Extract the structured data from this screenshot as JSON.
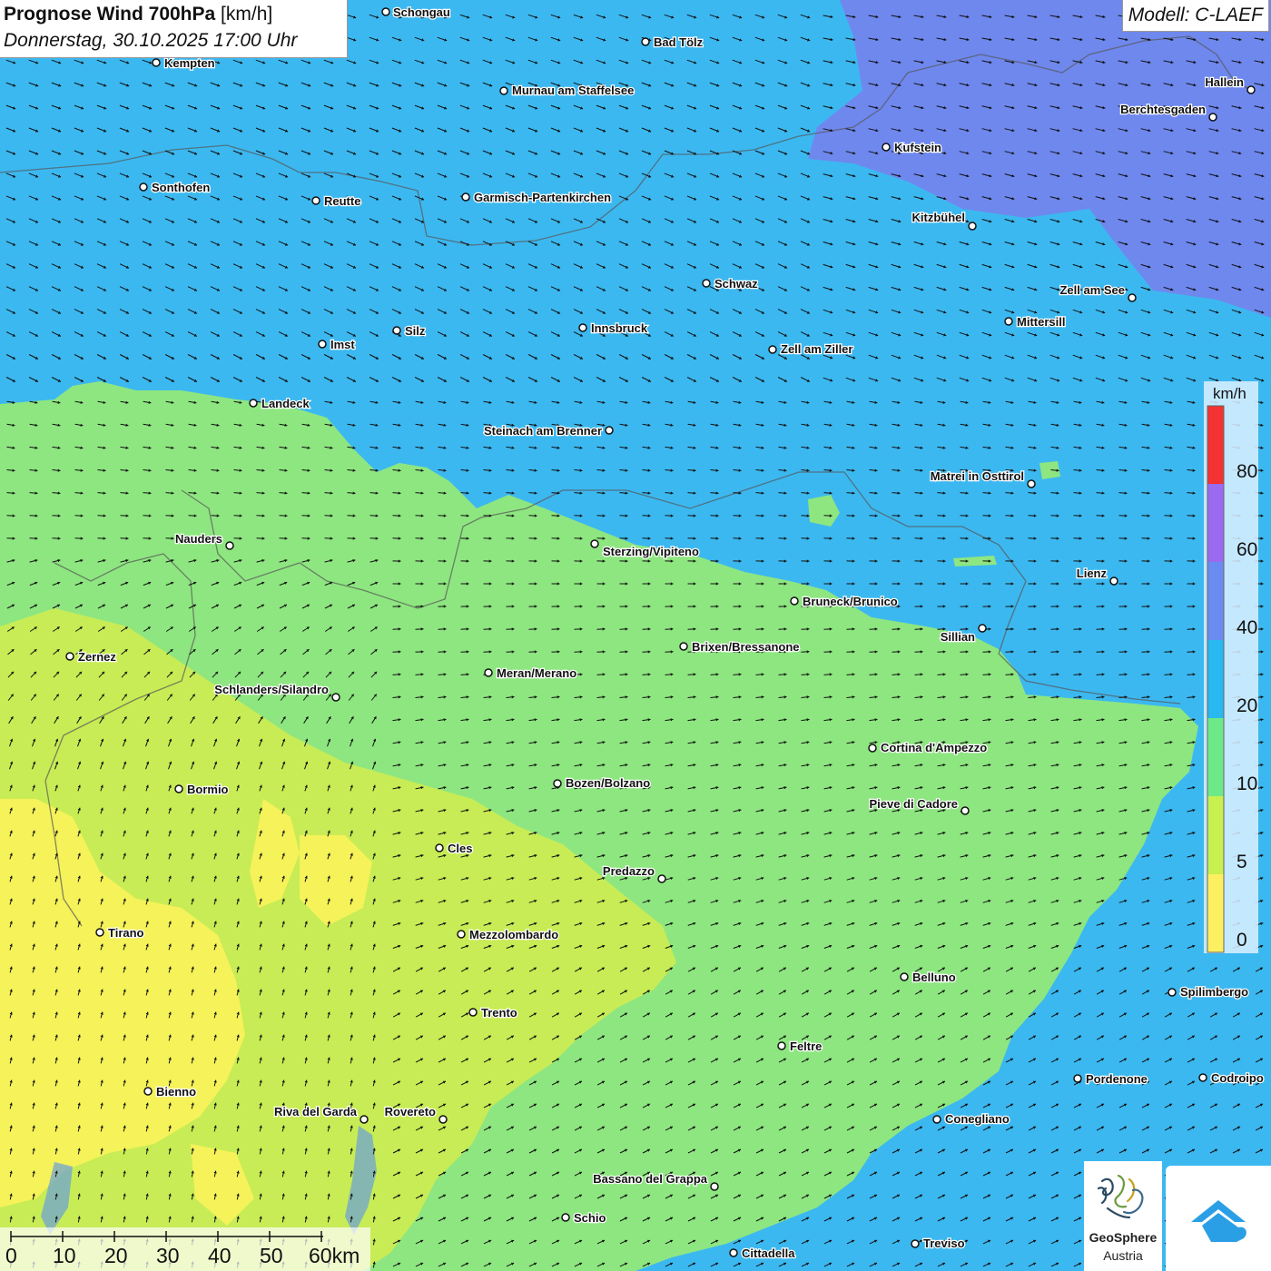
{
  "title": {
    "main": "Prognose Wind 700hPa",
    "unit": "[km/h]",
    "datetime": "Donnerstag, 30.10.2025 17:00 Uhr"
  },
  "model": "Modell: C-LAEF",
  "legend": {
    "unit": "km/h",
    "labels": [
      "80",
      "60",
      "40",
      "20",
      "10",
      "5",
      "0"
    ],
    "colors": [
      "#f33333",
      "#9a6af0",
      "#6a8cf0",
      "#29b8f0",
      "#6ee98a",
      "#c8f050",
      "#fcf060"
    ]
  },
  "scalebar": {
    "labels": [
      "0",
      "10",
      "20",
      "30",
      "40",
      "50",
      "60km"
    ]
  },
  "logos": {
    "geosphere_name": "GeoSphere",
    "geosphere_sub": "Austria"
  },
  "colors": {
    "wind_0_5": "#f5f25a",
    "wind_5_10": "#c8ec55",
    "wind_10_20": "#8ee680",
    "wind_20_40": "#3cb8f0",
    "wind_40_60": "#6f88ee",
    "city_dot": "#ffffff",
    "label": "#111111"
  },
  "cities": [
    {
      "name": "Schongau"
    },
    {
      "name": "Bad Tölz"
    },
    {
      "name": "Kempten"
    },
    {
      "name": "Murnau am Staffelsee"
    },
    {
      "name": "Hallein"
    },
    {
      "name": "Berchtesgaden"
    },
    {
      "name": "Kufstein"
    },
    {
      "name": "Sonthofen"
    },
    {
      "name": "Reutte"
    },
    {
      "name": "Garmisch-Partenkirchen"
    },
    {
      "name": "Kitzbühel"
    },
    {
      "name": "Schwaz"
    },
    {
      "name": "Zell am See"
    },
    {
      "name": "Mittersill"
    },
    {
      "name": "Innsbruck"
    },
    {
      "name": "Silz"
    },
    {
      "name": "Imst"
    },
    {
      "name": "Zell am Ziller"
    },
    {
      "name": "Landeck"
    },
    {
      "name": "Steinach am Brenner"
    },
    {
      "name": "Matrei in Osttirol"
    },
    {
      "name": "Nauders"
    },
    {
      "name": "Sterzing/Vipiteno"
    },
    {
      "name": "Lienz"
    },
    {
      "name": "Bruneck/Brunico"
    },
    {
      "name": "Sillian"
    },
    {
      "name": "Brixen/Bressanone"
    },
    {
      "name": "Zernez"
    },
    {
      "name": "Meran/Merano"
    },
    {
      "name": "Schlanders/Silandro"
    },
    {
      "name": "Cortina d'Ampezzo"
    },
    {
      "name": "Bozen/Bolzano"
    },
    {
      "name": "Bormio"
    },
    {
      "name": "Pieve di Cadore"
    },
    {
      "name": "Cles"
    },
    {
      "name": "Predazzo"
    },
    {
      "name": "Tirano"
    },
    {
      "name": "Mezzolombardo"
    },
    {
      "name": "Belluno"
    },
    {
      "name": "Spilimbergo"
    },
    {
      "name": "Trento"
    },
    {
      "name": "Feltre"
    },
    {
      "name": "Pordenone"
    },
    {
      "name": "Codroipo"
    },
    {
      "name": "Bienno"
    },
    {
      "name": "Riva del Garda"
    },
    {
      "name": "Rovereto"
    },
    {
      "name": "Conegliano"
    },
    {
      "name": "Bassano del Grappa"
    },
    {
      "name": "Schio"
    },
    {
      "name": "Treviso"
    },
    {
      "name": "Cittadella"
    }
  ]
}
